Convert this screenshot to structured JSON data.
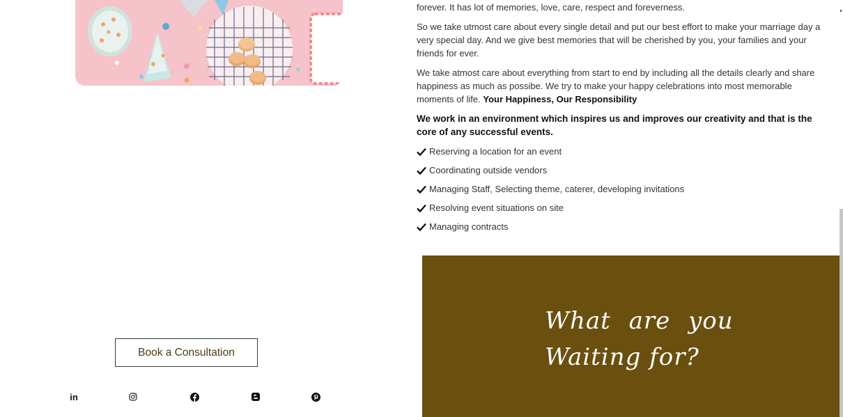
{
  "content": {
    "para_cut": "forever. It has lot of memories, love, care, respect and foreverness.",
    "para1": "So we take utmost care about every single detail and put our best effort to make your marriage day a very special day. And we give best memories that will be cherished by you, your families and your friends for ever.",
    "para2": "We take atmost care about everything from start to end by including all the details clearly and share happiness as much as possibe. We try to make your happy celebrations into most memorable moments of life.",
    "para2_bold": "Your Happiness, Our Responsibility",
    "para3": "We work in an environment which inspires us and improves our creativity and that is the core of any successful events.",
    "checklist": [
      "Reserving a location for an event",
      "Coordinating outside vendors",
      "Managing Staff, Selecting theme, caterer, developing invitations",
      "Resolving event situations on site",
      "Managing contracts"
    ]
  },
  "cta": {
    "line1": "What are you",
    "line2": "Waiting for?"
  },
  "book_button": "Book a Consultation",
  "social": {
    "linkedin": "in"
  },
  "colors": {
    "cta_background": "#6a4f0e",
    "button_text": "#4d3a10"
  },
  "icons": [
    "check-icon",
    "linkedin-icon",
    "instagram-icon",
    "facebook-icon",
    "blogger-icon",
    "pinterest-icon"
  ]
}
